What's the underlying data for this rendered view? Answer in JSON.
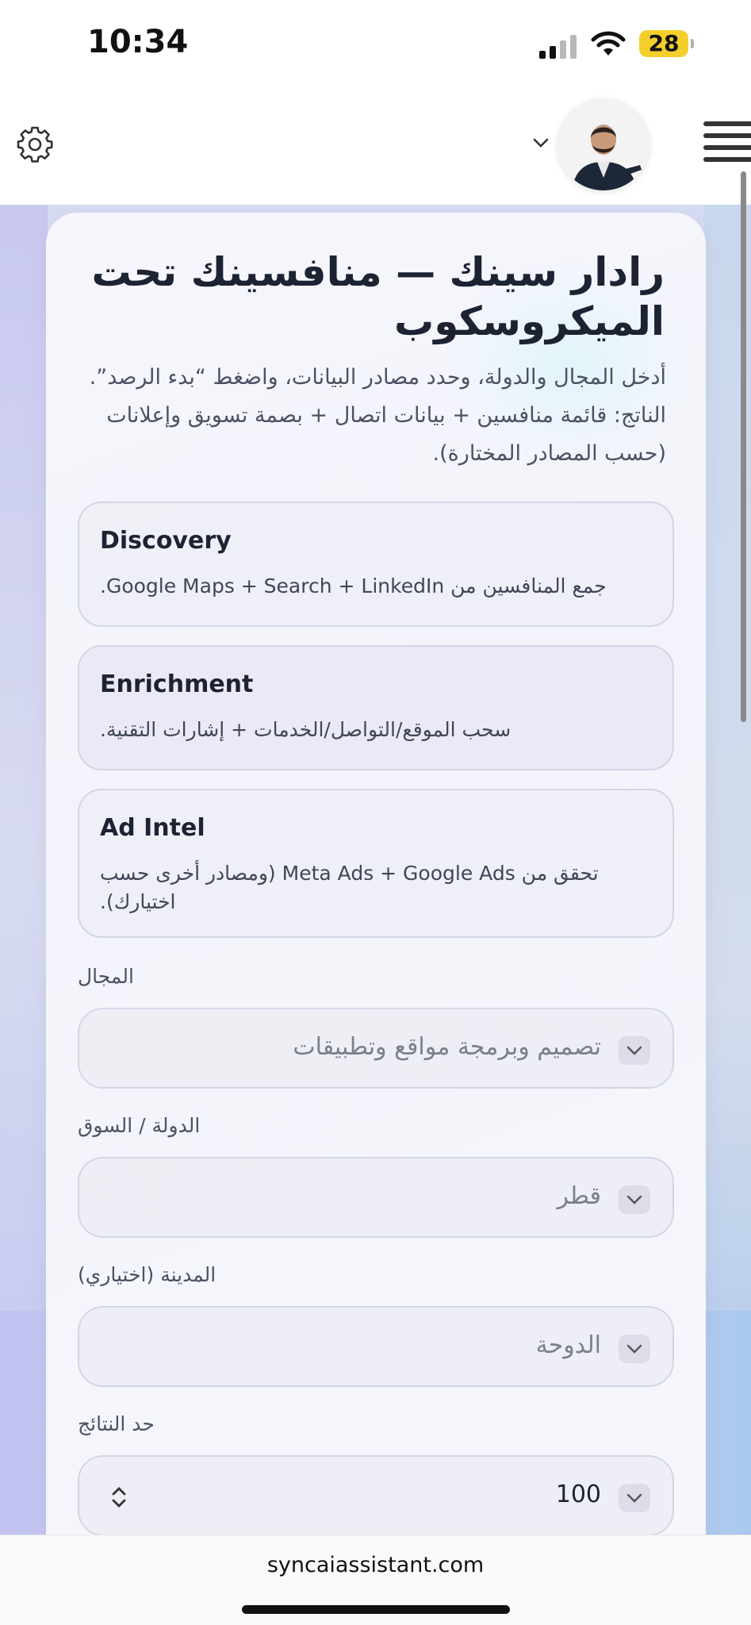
{
  "status_bar": {
    "time": "10:34",
    "battery": "28",
    "icons": [
      "signal-icon",
      "wifi-icon",
      "battery-icon"
    ]
  },
  "header": {
    "icons": [
      "gear-icon",
      "chevron-down-icon",
      "menu-icon"
    ],
    "avatar": "avatar"
  },
  "main": {
    "title": "رادار سينك — منافسينك تحت الميكروسكوب",
    "description": "أدخل المجال والدولة، وحدد مصادر البيانات، واضغط “بدء الرصد”. الناتج: قائمة منافسين + بيانات اتصال + بصمة تسويق وإعلانات (حسب المصادر المختارة).",
    "features": [
      {
        "title": "Discovery",
        "description": "جمع المنافسين من Google Maps + Search + LinkedIn."
      },
      {
        "title": "Enrichment",
        "description": "سحب الموقع/التواصل/الخدمات + إشارات التقنية."
      },
      {
        "title": "Ad Intel",
        "description": "تحقق من Meta Ads + Google Ads (ومصادر أخرى حسب اختيارك)."
      }
    ],
    "fields": {
      "domain": {
        "label": "المجال",
        "value": "تصميم وبرمجة مواقع وتطبيقات"
      },
      "country": {
        "label": "الدولة / السوق",
        "value": "قطر"
      },
      "city": {
        "label": "المدينة (اختياري)",
        "value": "الدوحة"
      },
      "limit": {
        "label": "حد النتائج",
        "value": "100"
      }
    }
  },
  "browser": {
    "url": "syncaiassistant.com"
  },
  "colors": {
    "text_primary": "#1c2333",
    "text_secondary": "#4b5263",
    "card_border": "#d4d6e6",
    "battery": "#f4cf2c"
  }
}
